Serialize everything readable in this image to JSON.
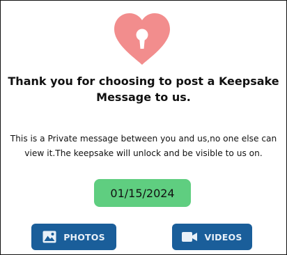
{
  "icons": {
    "heart_lock": "heart-lock-icon",
    "photo": "image-icon",
    "video": "video-camera-icon"
  },
  "colors": {
    "heart": "#f28d8d",
    "date_badge": "#5fce80",
    "button": "#1a5e9a",
    "button_text": "#e8f0f8"
  },
  "message": {
    "title_line1": "Thank you for choosing to post a Keepsake",
    "title_line2": "Message to us.",
    "body_line1": "This is a Private message between you and us,no one else can",
    "body_line2": "view it.The keepsake will unlock and be visible to us on.",
    "unlock_date": "01/15/2024"
  },
  "buttons": {
    "photos_label": "PHOTOS",
    "videos_label": "VIDEOS"
  }
}
